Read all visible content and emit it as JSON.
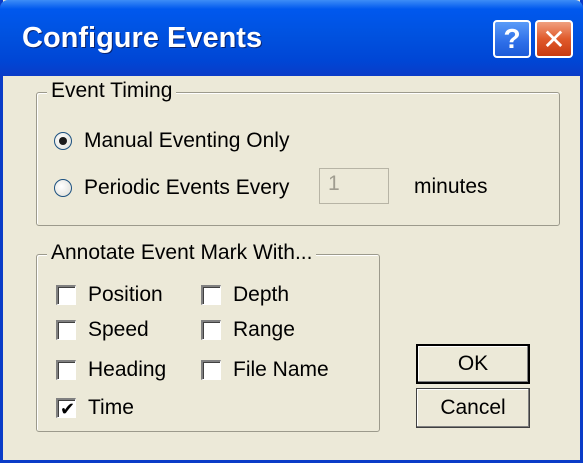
{
  "window": {
    "title": "Configure Events"
  },
  "titlebar": {
    "help_glyph": "?",
    "close_glyph": "✕"
  },
  "event_timing": {
    "label": "Event Timing",
    "manual_label": "Manual Eventing Only",
    "manual_selected": true,
    "periodic_label": "Periodic Events Every",
    "periodic_selected": false,
    "interval_value": "1",
    "interval_unit": "minutes"
  },
  "annotate": {
    "label": "Annotate Event Mark With...",
    "position": {
      "label": "Position",
      "checked": false
    },
    "depth": {
      "label": "Depth",
      "checked": false
    },
    "speed": {
      "label": "Speed",
      "checked": false
    },
    "range": {
      "label": "Range",
      "checked": false
    },
    "heading": {
      "label": "Heading",
      "checked": false
    },
    "file_name": {
      "label": "File Name",
      "checked": false
    },
    "time": {
      "label": "Time",
      "checked": true
    },
    "check_glyph": "✔"
  },
  "buttons": {
    "ok": "OK",
    "cancel": "Cancel"
  }
}
